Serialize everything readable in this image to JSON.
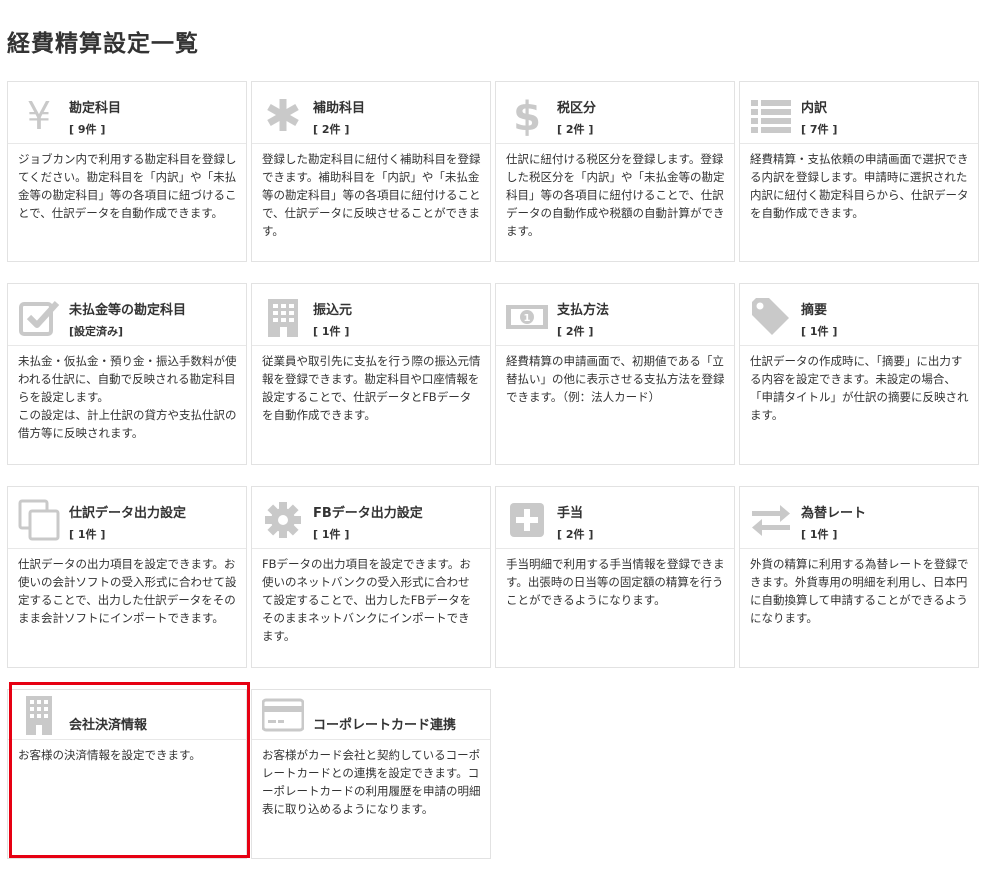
{
  "page": {
    "title": "経費精算設定一覧"
  },
  "cards": [
    {
      "title": "勘定科目",
      "count": "[ 9件 ]",
      "icon": "yen-icon",
      "desc": "ジョブカン内で利用する勘定科目を登録してください。勘定科目を「内訳」や「未払金等の勘定科目」等の各項目に紐づけることで、仕訳データを自動作成できます。"
    },
    {
      "title": "補助科目",
      "count": "[ 2件 ]",
      "icon": "asterisk-icon",
      "desc": "登録した勘定科目に紐付く補助科目を登録できます。補助科目を「内訳」や「未払金等の勘定科目」等の各項目に紐付けることで、仕訳データに反映させることができます。"
    },
    {
      "title": "税区分",
      "count": "[ 2件 ]",
      "icon": "dollar-icon",
      "desc": "仕訳に紐付ける税区分を登録します。登録した税区分を「内訳」や「未払金等の勘定科目」等の各項目に紐付けることで、仕訳データの自動作成や税額の自動計算ができます。"
    },
    {
      "title": "内訳",
      "count": "[ 7件 ]",
      "icon": "list-icon",
      "desc": "経費精算・支払依頼の申請画面で選択できる内訳を登録します。申請時に選択された内訳に紐付く勘定科目らから、仕訳データを自動作成できます。"
    },
    {
      "title": "未払金等の勘定科目",
      "count": "[設定済み]",
      "icon": "checkbox-icon",
      "desc": "未払金・仮払金・預り金・振込手数料が使われる仕訳に、自動で反映される勘定科目らを設定します。\nこの設定は、計上仕訳の貸方や支払仕訳の借方等に反映されます。"
    },
    {
      "title": "振込元",
      "count": "[ 1件 ]",
      "icon": "building-icon",
      "desc": "従業員や取引先に支払を行う際の振込元情報を登録できます。勘定科目や口座情報を設定することで、仕訳データとFBデータを自動作成できます。"
    },
    {
      "title": "支払方法",
      "count": "[ 2件 ]",
      "icon": "banknote-icon",
      "desc": "経費精算の申請画面で、初期値である「立替払い」の他に表示させる支払方法を登録できます。（例：法人カード）"
    },
    {
      "title": "摘要",
      "count": "[ 1件 ]",
      "icon": "tag-icon",
      "desc": "仕訳データの作成時に、「摘要」に出力する内容を設定できます。未設定の場合、「申請タイトル」が仕訳の摘要に反映されます。"
    },
    {
      "title": "仕訳データ出力設定",
      "count": "[ 1件 ]",
      "icon": "copy-icon",
      "desc": "仕訳データの出力項目を設定できます。お使いの会計ソフトの受入形式に合わせて設定することで、出力した仕訳データをそのまま会計ソフトにインポートできます。"
    },
    {
      "title": "FBデータ出力設定",
      "count": "[ 1件 ]",
      "icon": "gear-icon",
      "desc": "FBデータの出力項目を設定できます。お使いのネットバンクの受入形式に合わせて設定することで、出力したFBデータをそのままネットバンクにインポートできます。"
    },
    {
      "title": "手当",
      "count": "[ 2件 ]",
      "icon": "plus-square-icon",
      "desc": "手当明細で利用する手当情報を登録できます。出張時の日当等の固定額の精算を行うことができるようになります。"
    },
    {
      "title": "為替レート",
      "count": "[ 1件 ]",
      "icon": "exchange-icon",
      "desc": "外貨の精算に利用する為替レートを登録できます。外貨専用の明細を利用し、日本円に自動換算して申請することができるようになります。"
    },
    {
      "title": "会社決済情報",
      "count": "",
      "icon": "office-building-icon",
      "desc": "お客様の決済情報を設定できます。"
    },
    {
      "title": "コーポレートカード連携",
      "count": "",
      "icon": "credit-card-icon",
      "desc": "お客様がカード会社と契約しているコーポレートカードとの連携を設定できます。コーポレートカードの利用履歴を申請の明細表に取り込めるようになります。"
    }
  ],
  "colors": {
    "icon": "#c9c9c9",
    "highlight": "#e60012",
    "border": "#e2e2e2"
  }
}
